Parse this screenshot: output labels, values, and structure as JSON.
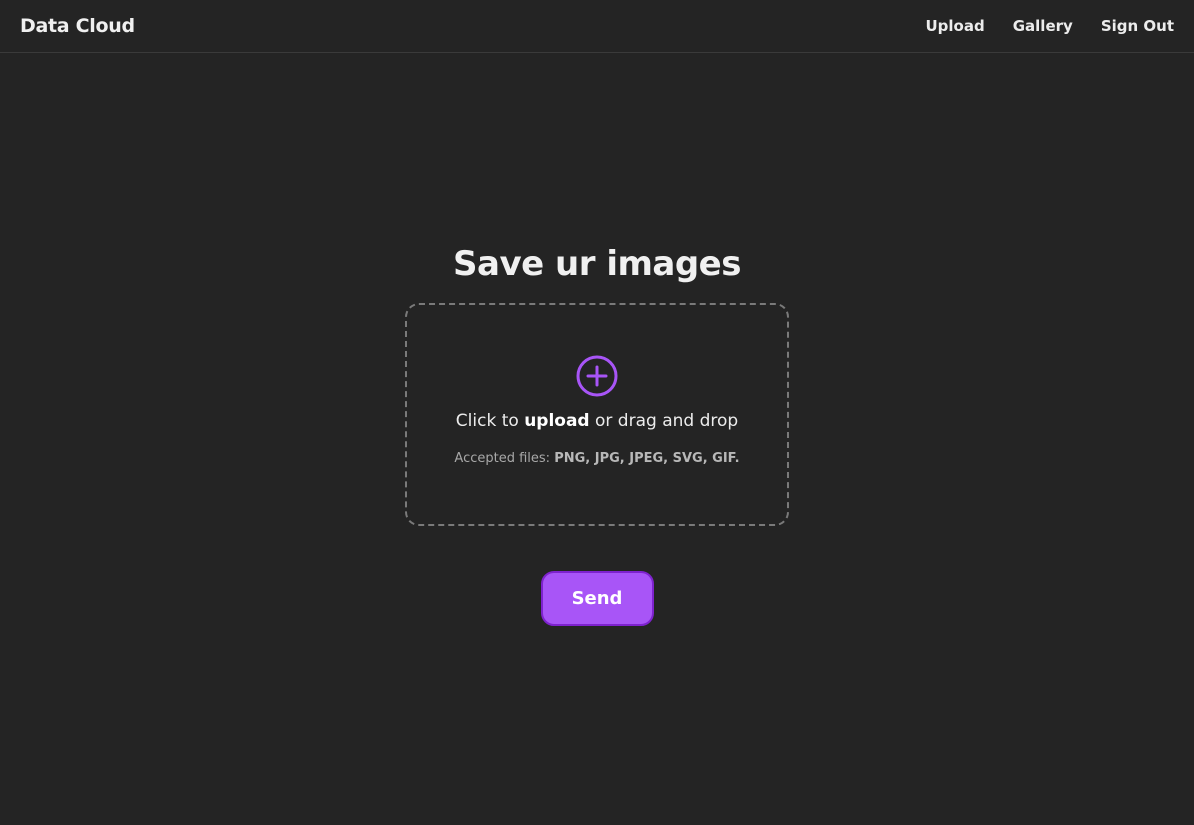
{
  "navbar": {
    "brand": "Data Cloud",
    "links": [
      {
        "label": "Upload"
      },
      {
        "label": "Gallery"
      },
      {
        "label": "Sign Out"
      }
    ]
  },
  "main": {
    "title": "Save ur images",
    "dropzone": {
      "icon": "plus-circle-icon",
      "prefix": "Click to ",
      "action": "upload",
      "suffix": " or drag and drop",
      "accepted_label": "Accepted files: ",
      "accepted_types": "PNG, JPG, JPEG, SVG, GIF."
    },
    "send_label": "Send"
  },
  "colors": {
    "background": "#242424",
    "accent": "#a855f7",
    "accent_border": "#7e22ce",
    "text": "#ececec"
  }
}
